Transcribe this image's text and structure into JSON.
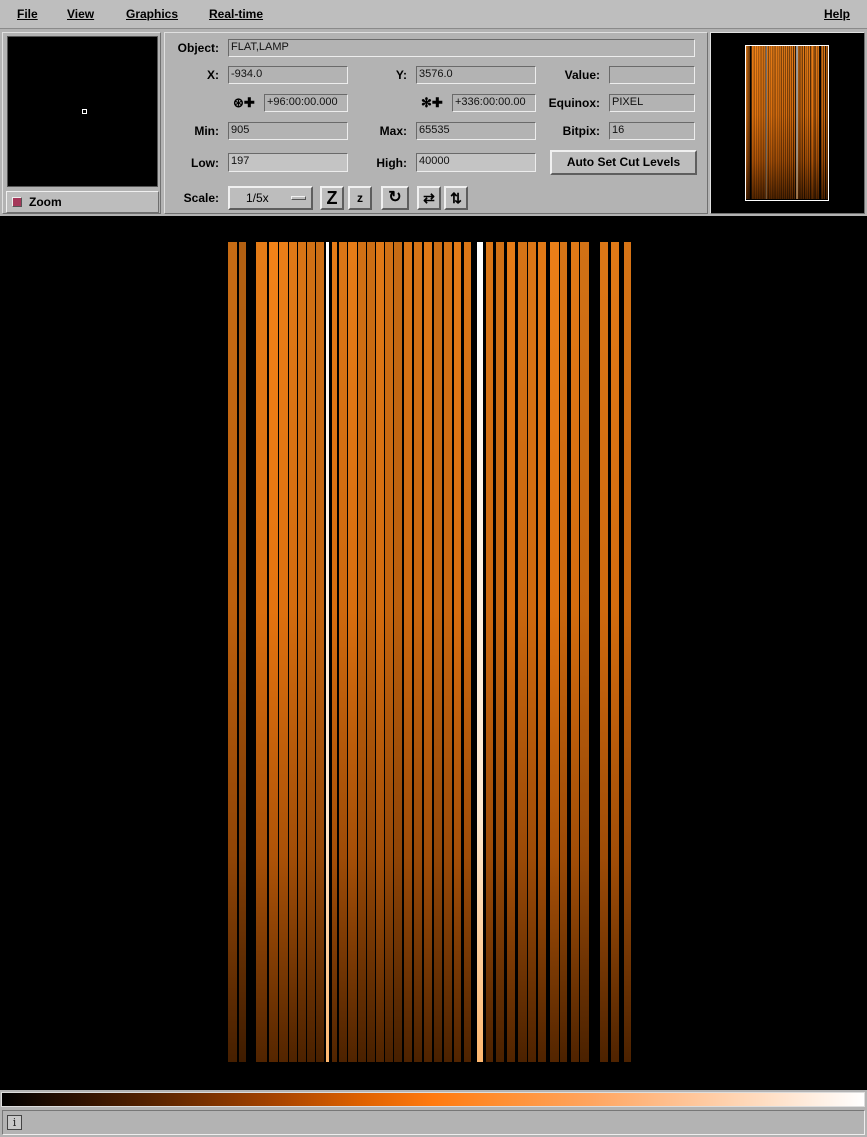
{
  "menu": {
    "file": "File",
    "view": "View",
    "graphics": "Graphics",
    "realtime": "Real-time",
    "help": "Help"
  },
  "zoom": {
    "label": "Zoom"
  },
  "info": {
    "object_label": "Object:",
    "object_value": "FLAT,LAMP",
    "x_label": "X:",
    "x_value": "-934.0",
    "y_label": "Y:",
    "y_value": "3576.0",
    "value_label": "Value:",
    "value_value": "",
    "ra_value": "+96:00:00.000",
    "dec_value": "+336:00:00.00",
    "equinox_label": "Equinox:",
    "equinox_value": "PIXEL",
    "min_label": "Min:",
    "min_value": "905",
    "max_label": "Max:",
    "max_value": "65535",
    "bitpix_label": "Bitpix:",
    "bitpix_value": "16",
    "low_label": "Low:",
    "low_value": "197",
    "high_label": "High:",
    "high_value": "40000",
    "autocut_label": "Auto Set Cut Levels",
    "scale_label": "Scale:",
    "scale_value": "1/5x"
  },
  "toolbar": {
    "zoom_in_glyph": "Z",
    "zoom_out_glyph": "z",
    "rotate_glyph": "↻",
    "flip_x_glyph": "⇄",
    "flip_y_glyph": "⇅"
  },
  "icons": {
    "ra_icon": "globe-plus-icon",
    "dec_icon": "star-plus-icon",
    "status_icon": "info-icon"
  },
  "status": {
    "icon_glyph": "i",
    "text": ""
  },
  "colors": {
    "accent_orange": "#ff7f0e",
    "ui_gray": "#b3b3b3",
    "image_background": "#000000"
  }
}
